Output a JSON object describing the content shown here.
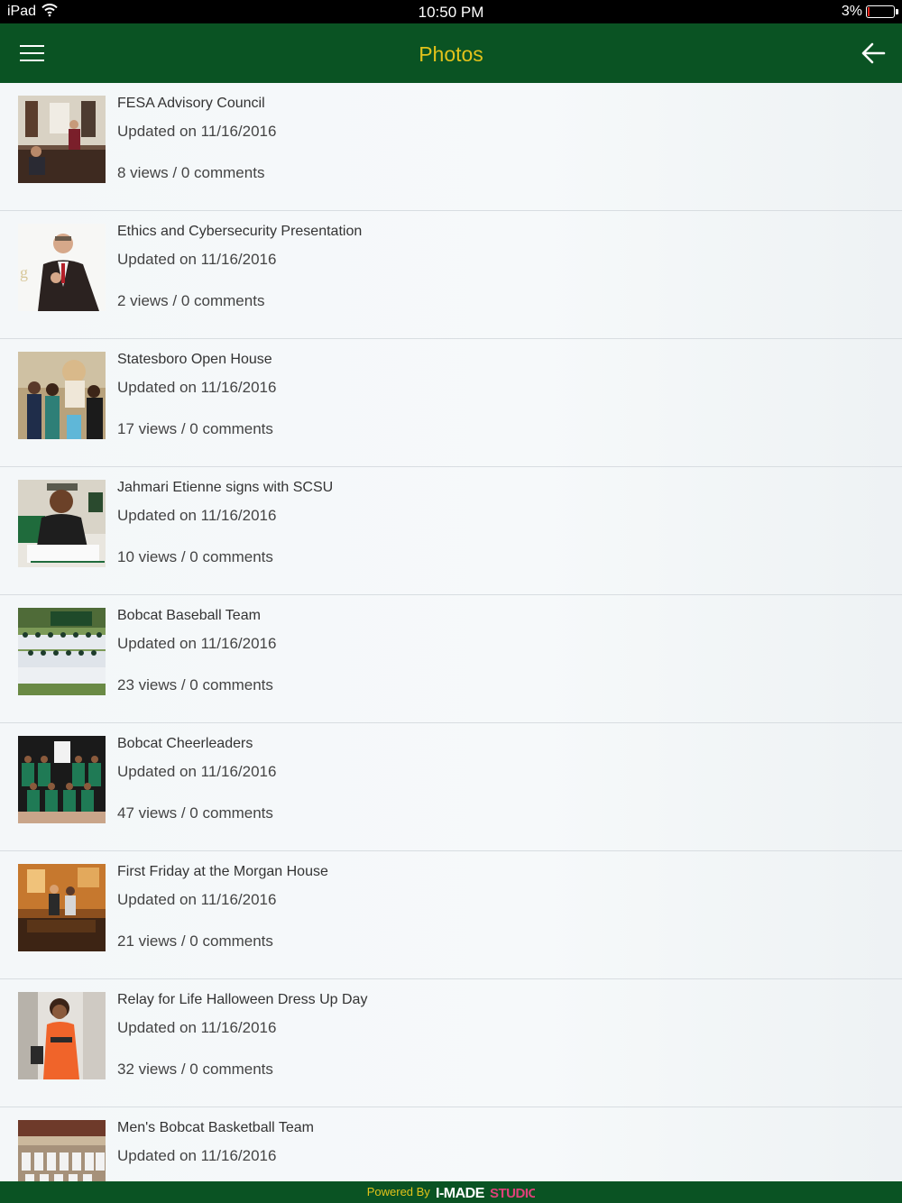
{
  "status_bar": {
    "device": "iPad",
    "time": "10:50 PM",
    "battery": "3%",
    "battery_level": 0.03
  },
  "nav": {
    "title": "Photos",
    "menu_icon": "hamburger-menu-icon",
    "back_icon": "arrow-left-icon"
  },
  "albums": [
    {
      "title": "FESA Advisory Council",
      "updated": "Updated on 11/16/2016",
      "stats": "8 views / 0 comments"
    },
    {
      "title": "Ethics and Cybersecurity Presentation",
      "updated": "Updated on 11/16/2016",
      "stats": "2 views / 0 comments"
    },
    {
      "title": "Statesboro Open House",
      "updated": "Updated on 11/16/2016",
      "stats": "17 views / 0 comments"
    },
    {
      "title": "Jahmari Etienne signs with SCSU",
      "updated": "Updated on 11/16/2016",
      "stats": "10 views / 0 comments"
    },
    {
      "title": "Bobcat Baseball Team",
      "updated": "Updated on 11/16/2016",
      "stats": "23 views / 0 comments"
    },
    {
      "title": "Bobcat Cheerleaders",
      "updated": "Updated on 11/16/2016",
      "stats": "47 views / 0 comments"
    },
    {
      "title": "First Friday at the Morgan House",
      "updated": "Updated on 11/16/2016",
      "stats": "21 views / 0 comments"
    },
    {
      "title": "Relay for Life Halloween Dress Up Day",
      "updated": "Updated on 11/16/2016",
      "stats": "32 views / 0 comments"
    },
    {
      "title": "Men's Bobcat Basketball Team",
      "updated": "Updated on 11/16/2016",
      "stats": ""
    }
  ],
  "footer": {
    "powered_by": "Powered By",
    "brand": "I-MADE STUDIO"
  },
  "colors": {
    "nav_green": "#0a5323",
    "title_gold": "#e2c21b",
    "brand_pink": "#e0407a"
  }
}
